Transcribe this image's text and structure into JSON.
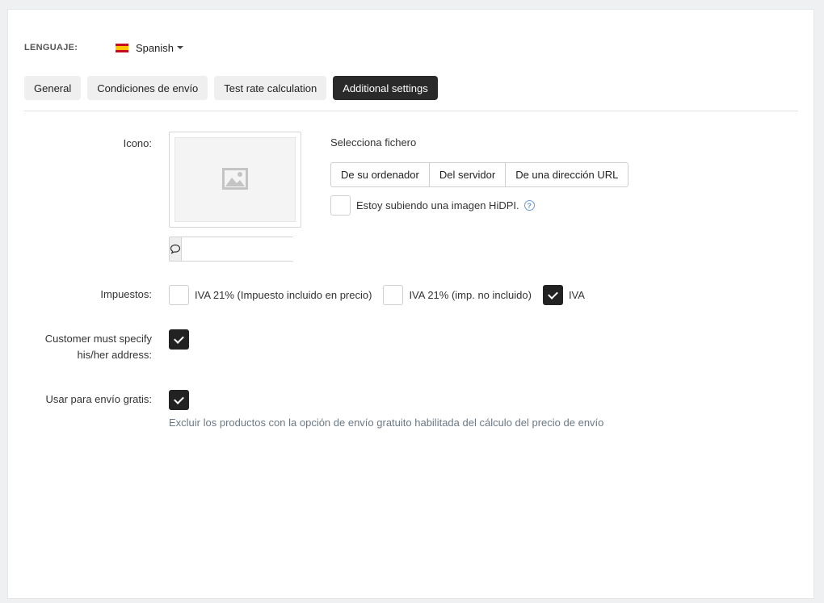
{
  "language": {
    "label": "LENGUAJE:",
    "value": "Spanish",
    "flag": "spain-flag"
  },
  "tabs": [
    {
      "label": "General",
      "active": false
    },
    {
      "label": "Condiciones de envío",
      "active": false
    },
    {
      "label": "Test rate calculation",
      "active": false
    },
    {
      "label": "Additional settings",
      "active": true
    }
  ],
  "icon_field": {
    "label": "Icono:",
    "select_file_title": "Selecciona fichero",
    "buttons": [
      "De su ordenador",
      "Del servidor",
      "De una dirección URL"
    ],
    "hidpi_label": "Estoy subiendo una imagen HiDPI.",
    "hidpi_checked": false,
    "alt_text_value": ""
  },
  "taxes": {
    "label": "Impuestos:",
    "options": [
      {
        "label": "IVA 21% (Impuesto incluido en precio)",
        "checked": false
      },
      {
        "label": "IVA 21% (imp. no incluido)",
        "checked": false
      },
      {
        "label": "IVA",
        "checked": true
      }
    ]
  },
  "customer_address": {
    "label_line1": "Customer must specify",
    "label_line2": "his/her address:",
    "checked": true
  },
  "free_shipping": {
    "label": "Usar para envío gratis:",
    "checked": true,
    "hint": "Excluir los productos con la opción de envío gratuito habilitada del cálculo del precio de envío"
  },
  "colors": {
    "accent": "#2a2a2a",
    "hint": "#6b7885",
    "help": "#6a9bd8"
  }
}
